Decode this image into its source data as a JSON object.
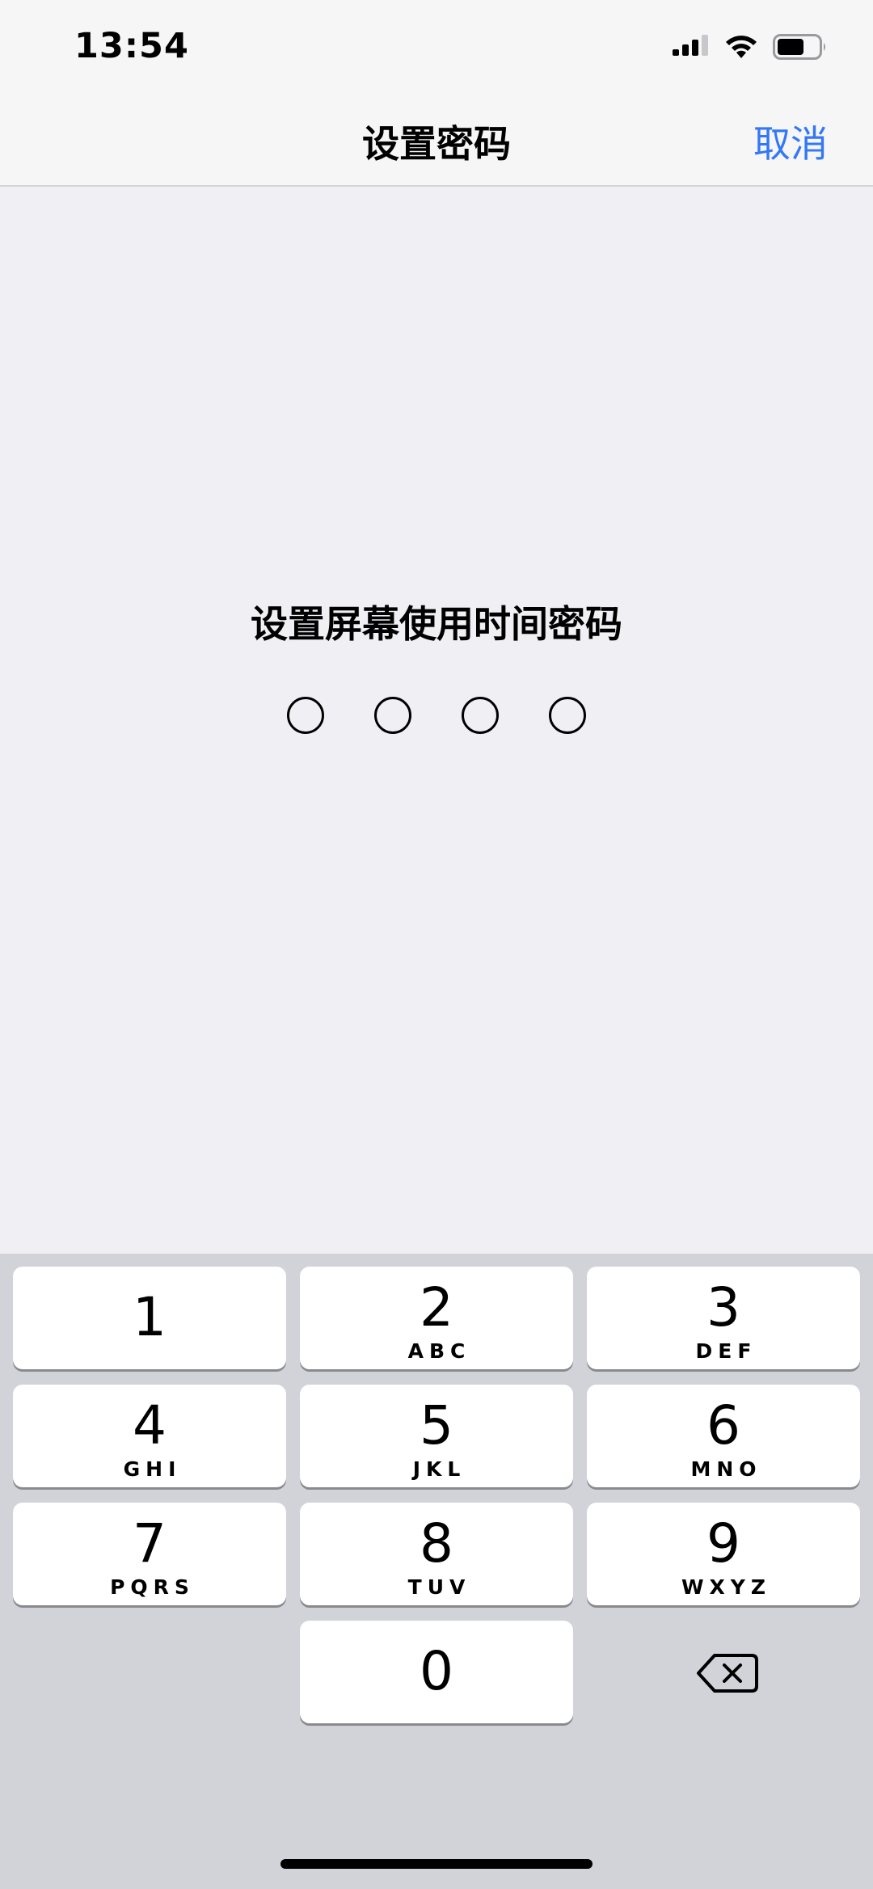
{
  "status_bar": {
    "time": "13:54"
  },
  "nav": {
    "title": "设置密码",
    "cancel_label": "取消"
  },
  "content": {
    "prompt": "设置屏幕使用时间密码",
    "passcode_length": 4,
    "entered_digits": 0
  },
  "keypad": {
    "keys": [
      {
        "digit": "1",
        "letters": ""
      },
      {
        "digit": "2",
        "letters": "ABC"
      },
      {
        "digit": "3",
        "letters": "DEF"
      },
      {
        "digit": "4",
        "letters": "GHI"
      },
      {
        "digit": "5",
        "letters": "JKL"
      },
      {
        "digit": "6",
        "letters": "MNO"
      },
      {
        "digit": "7",
        "letters": "PQRS"
      },
      {
        "digit": "8",
        "letters": "TUV"
      },
      {
        "digit": "9",
        "letters": "WXYZ"
      },
      {
        "digit": "0",
        "letters": ""
      }
    ],
    "delete_icon": "backspace-icon"
  },
  "colors": {
    "accent": "#3478f6",
    "background": "#efeff4",
    "keypad_background": "#d1d3d9"
  }
}
